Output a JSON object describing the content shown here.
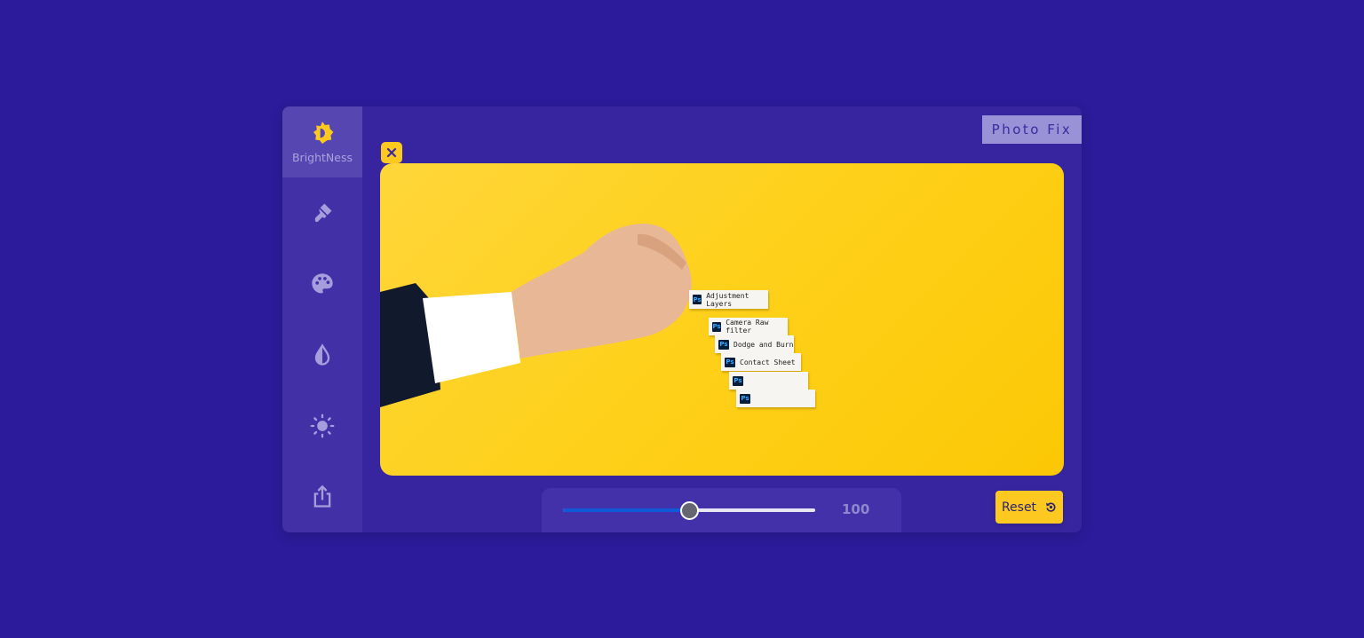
{
  "app": {
    "title": "Photo Fix",
    "colors": {
      "background": "#2c1b9a",
      "panel": "#37259f",
      "sidebar": "#4130a6",
      "accent": "#fdc820",
      "slider_fill": "#0f5ad8"
    }
  },
  "sidebar": {
    "items": [
      {
        "label": "BrightNess",
        "icon": "brightness-icon",
        "active": true
      },
      {
        "label": "",
        "icon": "paint-brush-icon",
        "active": false
      },
      {
        "label": "",
        "icon": "palette-icon",
        "active": false
      },
      {
        "label": "",
        "icon": "contrast-drop-icon",
        "active": false
      },
      {
        "label": "",
        "icon": "sun-icon",
        "active": false
      },
      {
        "label": "",
        "icon": "share-icon",
        "active": false
      }
    ]
  },
  "photo": {
    "description": "Hand placing Photoshop blocks on yellow background",
    "blocks": [
      "Adjustment Layers",
      "Camera Raw filter",
      "Dodge and Burn",
      "Contact Sheet",
      "",
      ""
    ],
    "badge": "Ps"
  },
  "close_icon": "close-icon",
  "slider": {
    "value": 100,
    "fill_fraction": 0.5,
    "display": "100"
  },
  "reset": {
    "label": "Reset",
    "icon": "reset-icon"
  }
}
